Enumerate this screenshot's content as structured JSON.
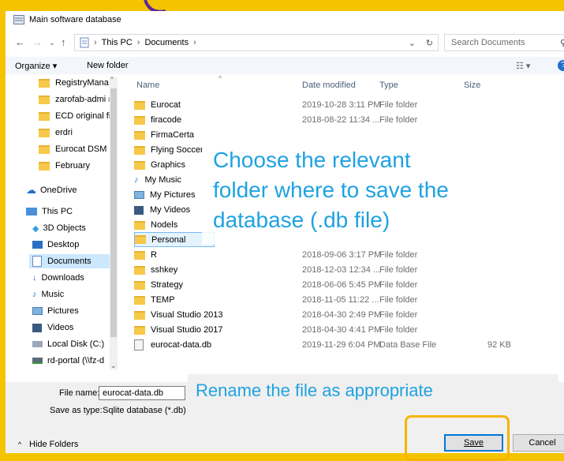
{
  "window": {
    "title": "Main software database"
  },
  "address": {
    "path": [
      "This PC",
      "Documents"
    ],
    "search_placeholder": "Search Documents"
  },
  "toolbar": {
    "organize": "Organize ▾",
    "new_folder": "New folder"
  },
  "nav_pane": [
    {
      "label": "RegistryMana",
      "icon": "folder-icon",
      "pinned": true
    },
    {
      "label": "zarofab-admi",
      "icon": "folder-icon",
      "pinned": true
    },
    {
      "label": "ECD original file",
      "icon": "folder-icon"
    },
    {
      "label": "erdri",
      "icon": "folder-icon"
    },
    {
      "label": "Eurocat DSM",
      "icon": "folder-icon"
    },
    {
      "label": "February",
      "icon": "folder-icon"
    },
    {
      "label": "OneDrive",
      "icon": "cloud-icon"
    },
    {
      "label": "This PC",
      "icon": "computer-icon"
    },
    {
      "label": "3D Objects",
      "icon": "3d-objects-icon"
    },
    {
      "label": "Desktop",
      "icon": "desktop-icon"
    },
    {
      "label": "Documents",
      "icon": "documents-icon",
      "selected": true
    },
    {
      "label": "Downloads",
      "icon": "download-icon"
    },
    {
      "label": "Music",
      "icon": "music-icon"
    },
    {
      "label": "Pictures",
      "icon": "pictures-icon"
    },
    {
      "label": "Videos",
      "icon": "videos-icon"
    },
    {
      "label": "Local Disk (C:)",
      "icon": "disk-icon"
    },
    {
      "label": "rd-portal (\\\\fz-d",
      "icon": "network-drive-icon"
    }
  ],
  "columns": {
    "name": "Name",
    "date": "Date modified",
    "type": "Type",
    "size": "Size"
  },
  "files": [
    {
      "name": "Eurocat",
      "date": "2019-10-28 3:11 PM",
      "type": "File folder",
      "size": "",
      "icon": "folder-icon"
    },
    {
      "name": "firacode",
      "date": "2018-08-22 11:34 ...",
      "type": "File folder",
      "size": "",
      "icon": "folder-icon"
    },
    {
      "name": "FirmaCerta",
      "date": "",
      "type": "",
      "size": "",
      "icon": "folder-icon"
    },
    {
      "name": "Flying Soccer",
      "date": "",
      "type": "",
      "size": "",
      "icon": "folder-icon"
    },
    {
      "name": "Graphics",
      "date": "",
      "type": "",
      "size": "",
      "icon": "folder-icon"
    },
    {
      "name": "My Music",
      "date": "",
      "type": "",
      "size": "",
      "icon": "music-icon"
    },
    {
      "name": "My Pictures",
      "date": "",
      "type": "",
      "size": "",
      "icon": "pictures-icon"
    },
    {
      "name": "My Videos",
      "date": "",
      "type": "",
      "size": "",
      "icon": "videos-icon"
    },
    {
      "name": "Nodels",
      "date": "",
      "type": "",
      "size": "",
      "icon": "folder-icon"
    },
    {
      "name": "Personal",
      "date": "",
      "type": "",
      "size": "",
      "icon": "folder-icon",
      "hovered": true
    },
    {
      "name": "R",
      "date": "2018-09-06 3:17 PM",
      "type": "File folder",
      "size": "",
      "icon": "folder-icon"
    },
    {
      "name": "sshkey",
      "date": "2018-12-03 12:34 ...",
      "type": "File folder",
      "size": "",
      "icon": "folder-icon"
    },
    {
      "name": "Strategy",
      "date": "2018-06-06 5:45 PM",
      "type": "File folder",
      "size": "",
      "icon": "folder-icon"
    },
    {
      "name": "TEMP",
      "date": "2018-11-05 11:22 ...",
      "type": "File folder",
      "size": "",
      "icon": "folder-icon"
    },
    {
      "name": "Visual Studio 2013",
      "date": "2018-04-30 2:49 PM",
      "type": "File folder",
      "size": "",
      "icon": "folder-icon"
    },
    {
      "name": "Visual Studio 2017",
      "date": "2018-04-30 4:41 PM",
      "type": "File folder",
      "size": "",
      "icon": "folder-icon"
    },
    {
      "name": "eurocat-data.db",
      "date": "2019-11-29 6:04 PM",
      "type": "Data Base File",
      "size": "92 KB",
      "icon": "db-file-icon"
    }
  ],
  "form": {
    "file_name_label": "File name:",
    "file_name_value": "eurocat-data.db",
    "save_as_label": "Save as type:",
    "save_as_value": "Sqlite database (*.db)"
  },
  "buttons": {
    "hide_folders": "Hide Folders",
    "save": "Save",
    "cancel": "Cancel"
  },
  "annotations": {
    "choose_folder": [
      "Choose the relevant",
      "folder where to save the",
      "database (.db file)"
    ],
    "rename": "Rename the file as appropriate"
  },
  "colors": {
    "annotation": "#1fa2e0",
    "highlight": "#f5b400",
    "background": "#f5c400"
  }
}
